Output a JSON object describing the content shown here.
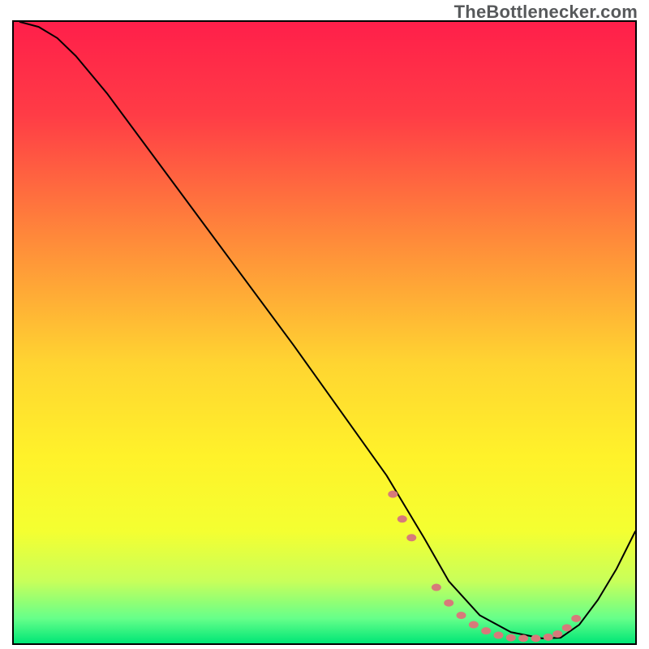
{
  "attribution": "TheBottlenecker.com",
  "chart_data": {
    "type": "line",
    "title": "",
    "xlabel": "",
    "ylabel": "",
    "xlim": [
      0,
      100
    ],
    "ylim": [
      0,
      100
    ],
    "background_gradient": {
      "stops": [
        {
          "offset": 0,
          "color": "#ff1f4a"
        },
        {
          "offset": 15,
          "color": "#ff3c46"
        },
        {
          "offset": 35,
          "color": "#ff8a3a"
        },
        {
          "offset": 55,
          "color": "#ffd531"
        },
        {
          "offset": 70,
          "color": "#fff22a"
        },
        {
          "offset": 82,
          "color": "#f4ff31"
        },
        {
          "offset": 90,
          "color": "#c8ff5a"
        },
        {
          "offset": 96,
          "color": "#66ff8a"
        },
        {
          "offset": 100,
          "color": "#00e676"
        }
      ]
    },
    "series": [
      {
        "name": "curve",
        "type": "line",
        "color": "#000000",
        "stroke_width": 2,
        "x": [
          1,
          4,
          7,
          10,
          15,
          25,
          35,
          45,
          55,
          60,
          63,
          66,
          70,
          75,
          80,
          85,
          88,
          91,
          94,
          97,
          100
        ],
        "y": [
          100,
          99.2,
          97.4,
          94.5,
          88.5,
          75,
          61.5,
          48,
          34,
          27,
          22,
          17,
          10,
          4.5,
          1.8,
          0.8,
          0.9,
          3,
          7,
          12,
          18
        ]
      },
      {
        "name": "optimum-band",
        "type": "scatter",
        "color": "#d77a7a",
        "marker_radius": 6,
        "x": [
          61,
          62.5,
          64,
          68,
          70,
          72,
          74,
          76,
          78,
          80,
          82,
          84,
          86,
          87.5,
          89,
          90.5
        ],
        "y": [
          24,
          20,
          17,
          9,
          6.5,
          4.5,
          3,
          2,
          1.3,
          0.9,
          0.8,
          0.8,
          1,
          1.5,
          2.5,
          4
        ]
      }
    ]
  }
}
